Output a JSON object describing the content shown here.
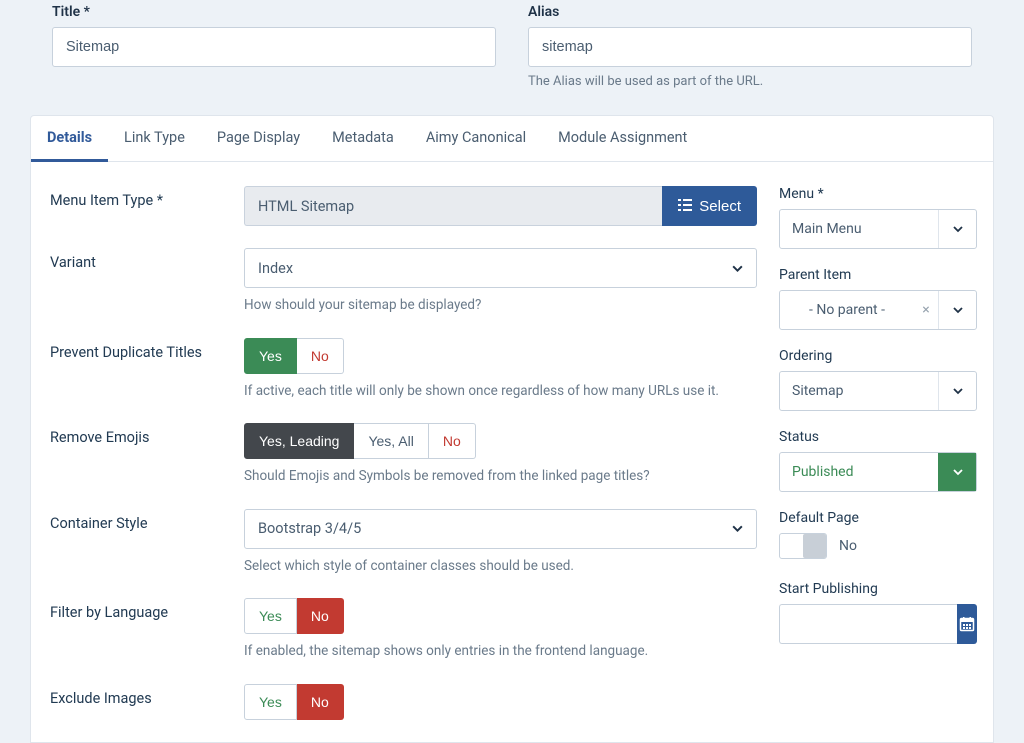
{
  "top": {
    "title_label": "Title",
    "title_value": "Sitemap",
    "alias_label": "Alias",
    "alias_value": "sitemap",
    "alias_help": "The Alias will be used as part of the URL."
  },
  "tabs": {
    "details": "Details",
    "link_type": "Link Type",
    "page_display": "Page Display",
    "metadata": "Metadata",
    "aimy_canonical": "Aimy Canonical",
    "module_assignment": "Module Assignment"
  },
  "fields": {
    "menu_item_type": {
      "label": "Menu Item Type",
      "value": "HTML Sitemap",
      "select_btn": "Select"
    },
    "variant": {
      "label": "Variant",
      "value": "Index",
      "desc": "How should your sitemap be displayed?"
    },
    "prevent_dup": {
      "label": "Prevent Duplicate Titles",
      "yes": "Yes",
      "no": "No",
      "desc": "If active, each title will only be shown once regardless of how many URLs use it."
    },
    "remove_emojis": {
      "label": "Remove Emojis",
      "yes_leading": "Yes, Leading",
      "yes_all": "Yes, All",
      "no": "No",
      "desc": "Should Emojis and Symbols be removed from the linked page titles?"
    },
    "container_style": {
      "label": "Container Style",
      "value": "Bootstrap 3/4/5",
      "desc": "Select which style of container classes should be used."
    },
    "filter_lang": {
      "label": "Filter by Language",
      "yes": "Yes",
      "no": "No",
      "desc": "If enabled, the sitemap shows only entries in the frontend language."
    },
    "exclude_images": {
      "label": "Exclude Images",
      "yes": "Yes",
      "no": "No"
    }
  },
  "side": {
    "menu": {
      "label": "Menu",
      "value": "Main Menu"
    },
    "parent_item": {
      "label": "Parent Item",
      "value": "- No parent -"
    },
    "ordering": {
      "label": "Ordering",
      "value": "Sitemap"
    },
    "status": {
      "label": "Status",
      "value": "Published"
    },
    "default_page": {
      "label": "Default Page",
      "value": "No"
    },
    "start_publishing": {
      "label": "Start Publishing"
    }
  }
}
